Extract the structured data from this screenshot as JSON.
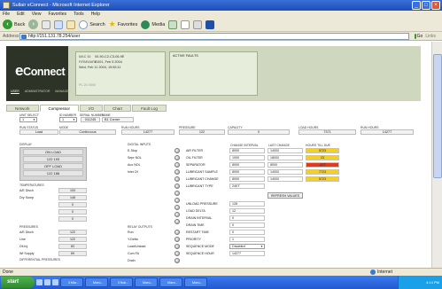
{
  "window": {
    "title": "Sullair eConnect - Microsoft Internet Explorer"
  },
  "menu": [
    "File",
    "Edit",
    "View",
    "Favorites",
    "Tools",
    "Help"
  ],
  "toolbar": {
    "back": "Back",
    "search": "Search",
    "favorites": "Favorites",
    "media": "Media"
  },
  "address": {
    "label": "Address",
    "url": "http://151.131.78.254/user",
    "go": "Go",
    "links": "Links"
  },
  "brand": {
    "logo_e": "e",
    "logo_rest": "Connect",
    "nav": [
      "USER",
      "ADMINISTRATOR",
      "MANAGER"
    ]
  },
  "info": {
    "mac_label": "MAC ID:",
    "mac": "00-90-C2-C3-06-9E",
    "firmware_label": "FIRMWARE:",
    "firmware": "2.001, Feb 5 2004",
    "datetime": "Wed, Feb 11 2004, 19:55:11",
    "footer": "PL 20 0000"
  },
  "faults": {
    "label": "ACTIVE FAULTS"
  },
  "tabs": [
    "Network",
    "Compressor",
    "I/O",
    "Chart",
    "Fault Log"
  ],
  "unit": {
    "labels": [
      "UNIT SELECT",
      "ID NUMBER",
      "SERIAL NUMBER",
      "NAME"
    ],
    "unit_select": "1",
    "id_number": "1",
    "serial": "011245",
    "name": "B1 Corner"
  },
  "status_row": {
    "labels": [
      "RUN STATUS",
      "MODE",
      "RUN HOURS",
      "PRESSURE",
      "CAPACITY",
      "LOAD HOURS",
      "RUN HOURS"
    ],
    "run_status": "Load",
    "mode": "Continuous",
    "run_hours": "14277",
    "pressure": "122",
    "capacity": "0",
    "load_hours": "7371",
    "run_hours_2": "14277"
  },
  "display": {
    "label": "DISPLAY",
    "lines": [
      "ON LOAD",
      "122 193",
      "OFF LOAD",
      "122 188"
    ]
  },
  "temperatures": {
    "label": "TEMPERATURES",
    "rows": [
      {
        "name": "A/E Disch",
        "value": "193"
      },
      {
        "name": "Dry Sump",
        "value": "148"
      },
      {
        "name": "",
        "value": "0"
      },
      {
        "name": "",
        "value": "0"
      },
      {
        "name": "",
        "value": "0"
      }
    ]
  },
  "pressures": {
    "label": "PRESSURES",
    "rows": [
      {
        "name": "A/E Disch",
        "value": "122"
      },
      {
        "name": "Line",
        "value": "122"
      },
      {
        "name": "Oil Inj",
        "value": "83"
      },
      {
        "name": "Wf Supply",
        "value": "69"
      }
    ],
    "diff_label": "DIFFERENTIAL PRESSURES"
  },
  "digital_inputs": {
    "label": "DIGITAL INPUTS",
    "items": [
      "E-Stop",
      "Sepr NOL",
      "Aux NOL",
      "Inlet Of"
    ]
  },
  "relay_outputs": {
    "label": "RELAY OUTPUTS",
    "items": [
      "Run",
      "Y-Delta",
      "Load/Unload",
      "Com FA",
      "Drain"
    ]
  },
  "maintenance": {
    "headers": [
      "CHANGE INTERVAL",
      "LAST CHANGE",
      "HOURS TILL DUE"
    ],
    "rows": [
      {
        "name": "AIR FILTER",
        "interval": "8000",
        "last": "14000",
        "due": "5723",
        "color": "#f5d020"
      },
      {
        "name": "OIL FILTER",
        "interval": "1000",
        "last": "18000",
        "due": "23",
        "color": "#f5d020"
      },
      {
        "name": "SEPARATOR",
        "interval": "8000",
        "last": "8000",
        "due": "-277",
        "color": "#e23a1a"
      },
      {
        "name": "LUBRICANT SAMPLE",
        "interval": "8000",
        "last": "14000",
        "due": "7723",
        "color": "#f5d020"
      },
      {
        "name": "LUBRICANT CHANGE",
        "interval": "8000",
        "last": "14000",
        "due": "5723",
        "color": "#f5d020"
      },
      {
        "name": "LUBRICANT TYPE",
        "interval": "24KT",
        "last": "",
        "due": "",
        "color": ""
      }
    ],
    "refresh_label": "REFRESH VALUES",
    "settings": [
      {
        "name": "UNLOAD PRESSURE",
        "value": "128"
      },
      {
        "name": "LOAD DELTA",
        "value": "12"
      },
      {
        "name": "DRAIN INTERVAL",
        "value": "0"
      },
      {
        "name": "DRAIN TIME",
        "value": "0"
      },
      {
        "name": "RESTART TIME",
        "value": "0"
      },
      {
        "name": "PRIORITY",
        "value": "1"
      },
      {
        "name": "SEQUENCE MODE",
        "value": "Disabled"
      },
      {
        "name": "SEQUENCE HOUR",
        "value": "14277"
      }
    ]
  },
  "status": {
    "left": "Done",
    "right": "Internet"
  },
  "taskbar": {
    "start": "start",
    "tasks": [
      "3 Micr...",
      "Micro...",
      "3 Nok...",
      "Micro...",
      "Micro...",
      "Micro..."
    ],
    "clock": "4:14 PM"
  }
}
